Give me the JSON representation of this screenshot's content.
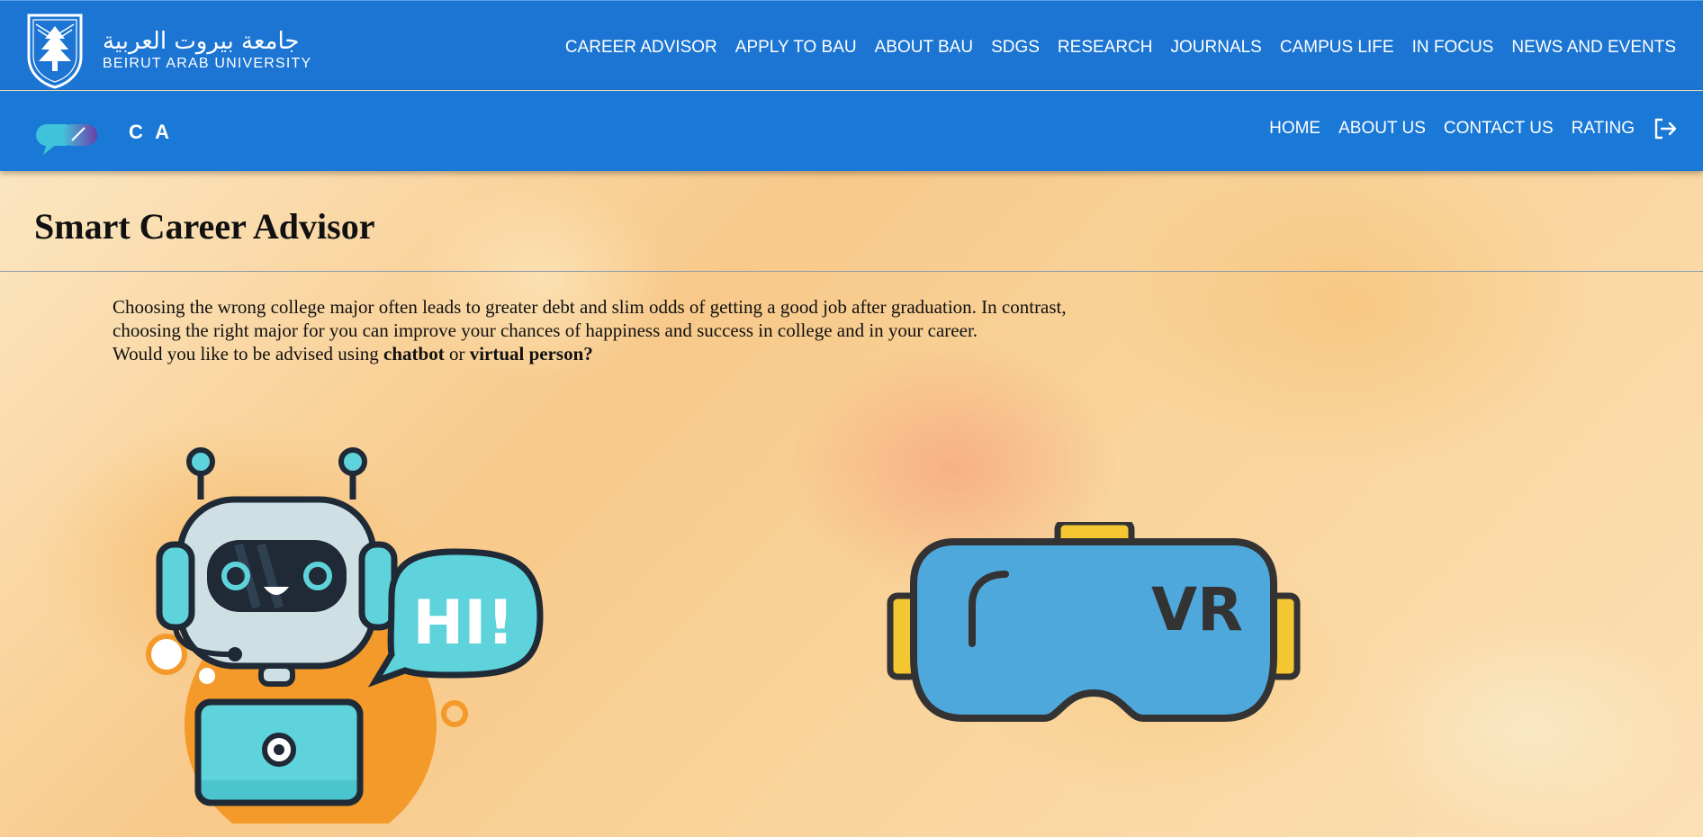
{
  "university": {
    "arabic_name": "جامعة بيروت العربية",
    "english_name": "BEIRUT ARAB UNIVERSITY"
  },
  "top_nav": [
    {
      "label": "CAREER ADVISOR"
    },
    {
      "label": "APPLY TO BAU"
    },
    {
      "label": "ABOUT BAU"
    },
    {
      "label": "SDGS"
    },
    {
      "label": "RESEARCH"
    },
    {
      "label": "JOURNALS"
    },
    {
      "label": "CAMPUS LIFE"
    },
    {
      "label": "IN FOCUS"
    },
    {
      "label": "NEWS AND EVENTS"
    }
  ],
  "sub_header": {
    "brand_text": "C A",
    "nav": [
      {
        "label": "HOME"
      },
      {
        "label": "ABOUT US"
      },
      {
        "label": "CONTACT US"
      },
      {
        "label": "RATING"
      }
    ],
    "logout_icon": "logout-icon"
  },
  "main": {
    "title": "Smart Career Advisor",
    "intro_line1": "Choosing the wrong college major often leads to greater debt and slim odds of getting a good job after graduation. In contrast,",
    "intro_line2": "choosing the right major for you can improve your chances of happiness and success in college and in your career.",
    "question_prefix": "Would you like to be advised using ",
    "option1": "chatbot",
    "question_or": " or ",
    "option2": "virtual person?",
    "chatbot_bubble_text": "HI!",
    "vr_label": "VR"
  },
  "colors": {
    "header_blue": "#1c75d2",
    "subheader_blue": "#1a78d6",
    "robot_teal": "#5fd3db",
    "vr_blue": "#4fa8db",
    "vr_yellow": "#f3c632",
    "outline": "#1f2a36"
  }
}
